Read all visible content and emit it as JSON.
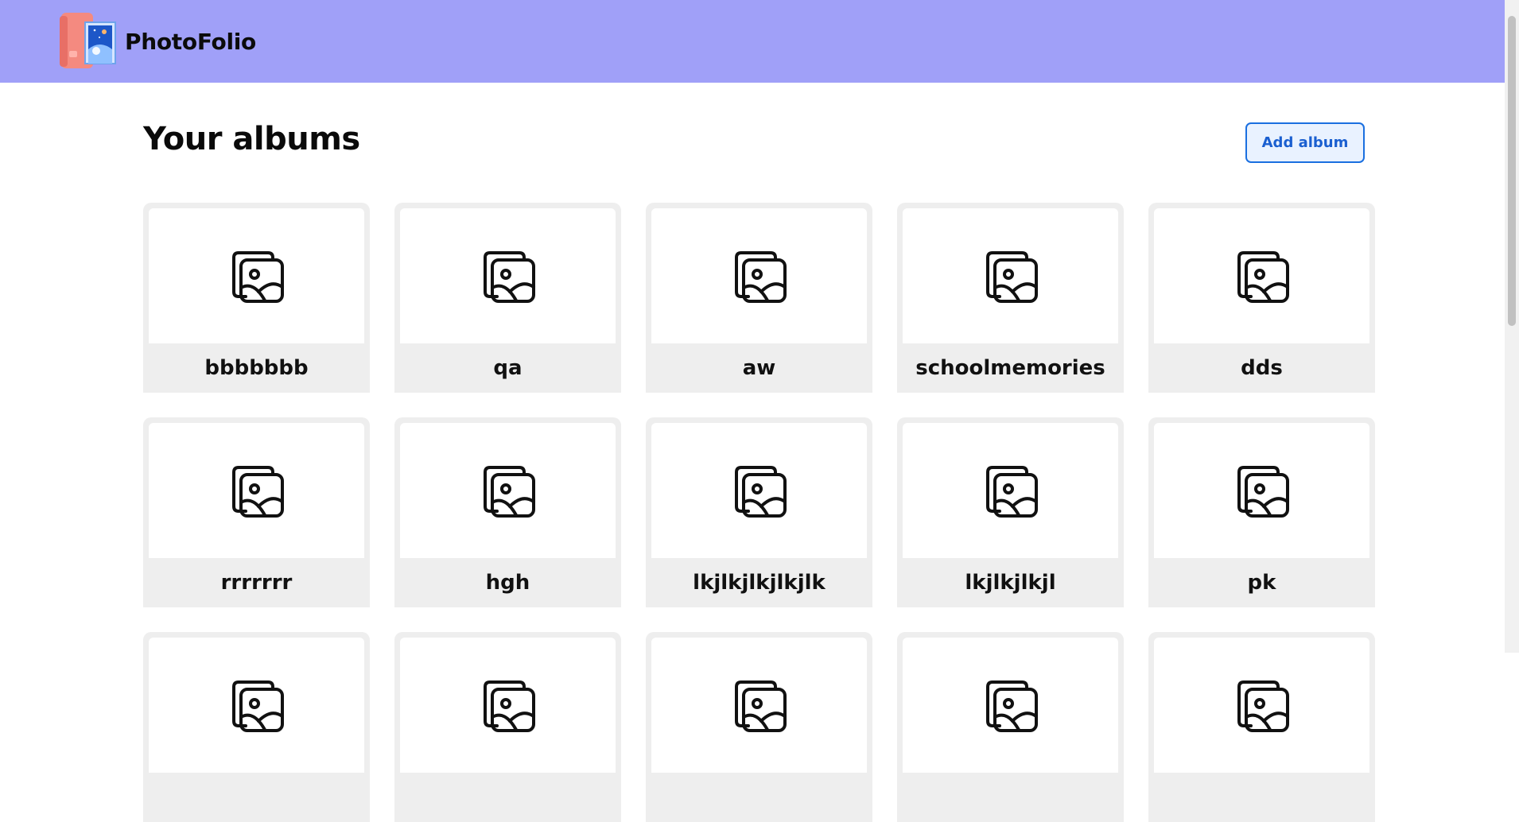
{
  "app": {
    "name": "PhotoFolio"
  },
  "page": {
    "title": "Your albums"
  },
  "actions": {
    "add_album_label": "Add album"
  },
  "albums": [
    {
      "name": "bbbbbbb"
    },
    {
      "name": "qa"
    },
    {
      "name": "aw"
    },
    {
      "name": "schoolmemories"
    },
    {
      "name": "dds"
    },
    {
      "name": "rrrrrrr"
    },
    {
      "name": "hgh"
    },
    {
      "name": "lkjlkjlkjlkjlk"
    },
    {
      "name": "lkjlkjlkjl"
    },
    {
      "name": "pk"
    },
    {
      "name": ""
    },
    {
      "name": ""
    },
    {
      "name": ""
    },
    {
      "name": ""
    },
    {
      "name": ""
    }
  ],
  "colors": {
    "navbar": "#a0a0f8",
    "accent": "#1a6fe0",
    "card": "#eeeeee"
  },
  "icons": {
    "logo": "photo-album-logo",
    "album": "album-images-icon"
  }
}
